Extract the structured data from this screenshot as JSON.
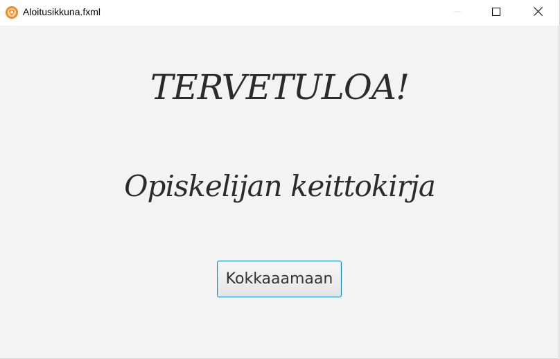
{
  "window": {
    "title": "Aloitusikkuna.fxml",
    "app_icon": "java-fx-icon",
    "controls": {
      "minimize_icon": "minimize-icon",
      "maximize_icon": "maximize-icon",
      "close_icon": "close-icon"
    }
  },
  "content": {
    "welcome": "TERVETULOA!",
    "subtitle": "Opiskelijan keittokirja",
    "start_button_label": "Kokkaaamaan"
  },
  "colors": {
    "background": "#f3f3f3",
    "titlebar": "#ffffff",
    "button_border": "#0a8ed8",
    "text": "#2b2b2b",
    "icon_orange": "#f08a24"
  }
}
